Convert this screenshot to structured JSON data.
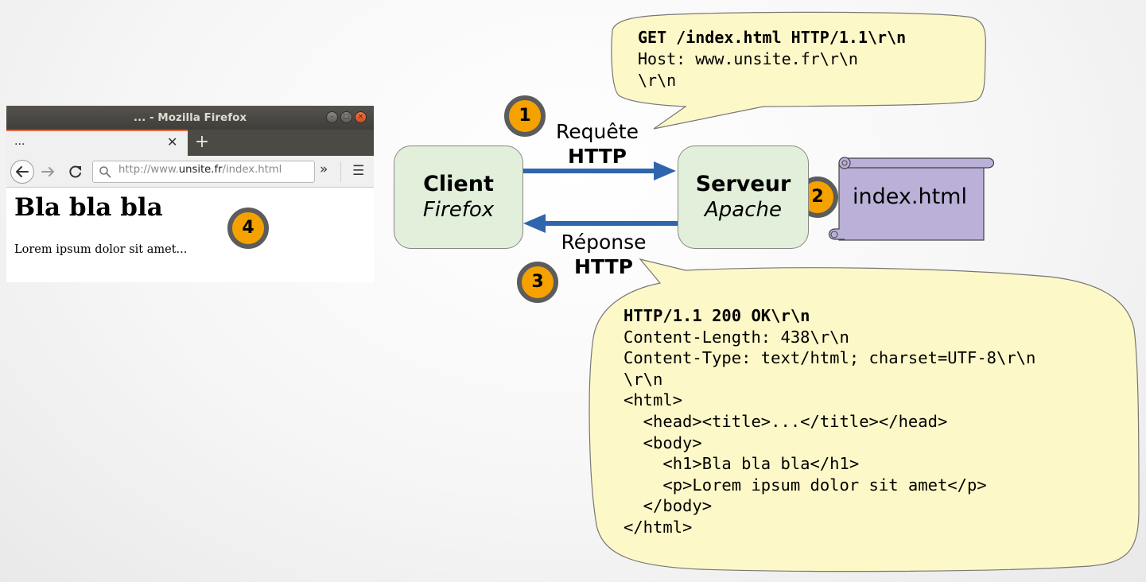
{
  "browser": {
    "window_title": "... - Mozilla Firefox",
    "tab_label": "...",
    "tab_close": "✕",
    "new_tab": "+",
    "url_prefix": "http://www.",
    "url_domain": "unsite.fr",
    "url_path": "/index.html",
    "overflow_icon": "»",
    "menu_icon": "☰",
    "page_heading": "Bla bla bla",
    "page_paragraph": "Lorem ipsum dolor sit amet..."
  },
  "steps": {
    "step1": "1",
    "step2": "2",
    "step3": "3",
    "step4": "4"
  },
  "client": {
    "title": "Client",
    "subtitle": "Firefox"
  },
  "server": {
    "title": "Serveur",
    "subtitle": "Apache"
  },
  "request_label": {
    "line1": "Requête",
    "line2": "HTTP"
  },
  "response_label": {
    "line1": "Réponse",
    "line2": "HTTP"
  },
  "file": {
    "name": "index.html"
  },
  "request": {
    "line1": "GET /index.html HTTP/1.1\\r\\n",
    "line2": "Host: www.unsite.fr\\r\\n",
    "line3": "\\r\\n"
  },
  "response": {
    "line1": "HTTP/1.1 200 OK\\r\\n",
    "line2": "Content-Length: 438\\r\\n",
    "line3": "Content-Type: text/html; charset=UTF-8\\r\\n",
    "line4": "\\r\\n",
    "line5": "<html>",
    "line6": "  <head><title>...</title></head>",
    "line7": "  <body>",
    "line8": "    <h1>Bla bla bla</h1>",
    "line9": "    <p>Lorem ipsum dolor sit amet</p>",
    "line10": "  </body>",
    "line11": "</html>"
  },
  "colors": {
    "badge": "#f5a200",
    "badge_ring": "#5c5c5c",
    "node_fill": "#e2efda",
    "arrow": "#2f65ad",
    "bubble_fill": "#fdf8c8",
    "scroll_fill": "#bbb0d8"
  }
}
